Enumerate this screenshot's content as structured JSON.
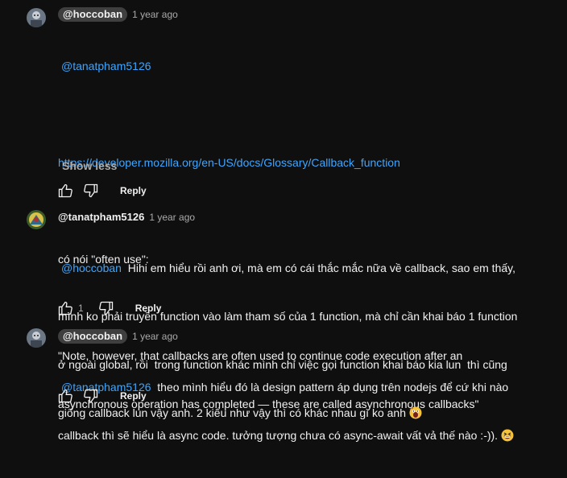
{
  "comments": [
    {
      "author": "@hoccoban",
      "time": "1 year ago",
      "mention": "@tanatpham5126",
      "link": "https://developer.mozilla.org/en-US/docs/Glossary/Callback_function",
      "line_often": "có nói \"often use\":",
      "quote_line1": "\"Note, however, that callbacks are often used to continue code execution after an",
      "quote_line2": "asynchronous operation has completed — these are called asynchronous callbacks\"",
      "show_less": "Show less",
      "reply_label": "Reply",
      "like_count": ""
    },
    {
      "author": "@tanatpham5126",
      "time": "1 year ago",
      "mention": "@hoccoban",
      "line1": "  Hihi em hiểu rồi anh ơi, mà em có cái thắc mắc nữa về callback, sao em thấy,",
      "line2": "mình ko phải truyền function vào làm tham số của 1 function, mà chỉ cần khai báo 1 function",
      "line3": "ở ngoài global, rồi  trong function khác mình chỉ việc gọi function khai báo kia lun  thì cũng",
      "line4": "giống callback lun vậy anh. 2 kiểu như vậy thì có khác nhau gì ko anh ",
      "like_count": "1",
      "reply_label": "Reply"
    },
    {
      "author": "@hoccoban",
      "time": "1 year ago",
      "mention": "@tanatpham5126",
      "line1": "  theo mình hiểu đó là design pattern áp dụng trên nodejs để cứ khi nào",
      "line2": "callback thì sẽ hiểu là async code. tưởng tượng chưa có async-await vất vả thế nào :-)). ",
      "reply_label": "Reply",
      "like_count": ""
    }
  ],
  "colors": {
    "background": "#0f0f0f",
    "text": "#f1f1f1",
    "muted": "#aaaaaa",
    "link": "#3ea6ff",
    "chip": "#3f3f3f"
  },
  "icons": [
    "avatar",
    "thumb-up-icon",
    "thumb-down-icon",
    "screaming-face-emoji",
    "grinning-squinting-face-emoji"
  ]
}
